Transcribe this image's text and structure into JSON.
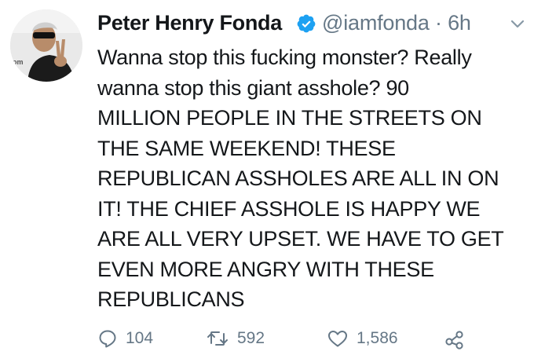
{
  "tweet": {
    "author_name": "Peter Henry Fonda",
    "handle": "@iamfonda",
    "separator": "·",
    "time": "6h",
    "avatar_caption": "om",
    "text": "Wanna stop this fucking monster? Really\nwanna stop this giant asshole? 90\nMILLION PEOPLE IN THE STREETS ON\nTHE SAME WEEKEND! THESE\nREPUBLICAN ASSHOLES ARE ALL IN ON\nIT! THE CHIEF ASSHOLE IS HAPPY WE\nARE ALL VERY UPSET. WE HAVE TO GET\nEVEN MORE ANGRY WITH THESE\nREPUBLICANS",
    "replies": "104",
    "retweets": "592",
    "likes": "1,586"
  },
  "icons": {
    "verified": "verified-badge-icon",
    "caret": "chevron-down-icon",
    "reply": "reply-icon",
    "retweet": "retweet-icon",
    "like": "heart-icon",
    "share": "share-icon"
  },
  "colors": {
    "text": "#14171a",
    "muted": "#657786",
    "verified_blue": "#1da1f2",
    "background": "#ffffff"
  }
}
